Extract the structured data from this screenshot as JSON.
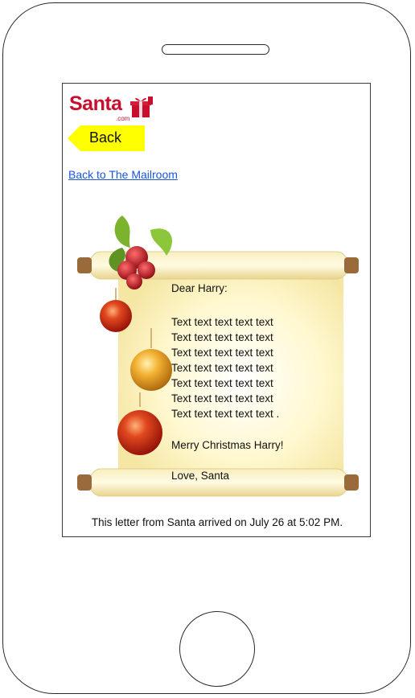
{
  "logo": {
    "brand": "Santa",
    "domain": ".com"
  },
  "nav": {
    "back_label": "Back",
    "mailroom_link": "Back to The Mailroom"
  },
  "letter": {
    "greeting": "Dear Harry:",
    "body_lines": [
      "Text text text text text",
      "Text text text text text",
      "Text text text text text",
      "Text text text text text",
      "Text text text text text",
      "Text text text text text",
      "Text text text text text  ."
    ],
    "closing": "Merry Christmas Harry!",
    "signoff": "Love, Santa"
  },
  "footer": {
    "arrival_text": "This letter from Santa arrived on July 26 at 5:02 PM."
  },
  "icons": {
    "logo_gift": "gift-icon",
    "back_arrow": "arrow-left-icon"
  },
  "colors": {
    "brand_red": "#c8102e",
    "back_yellow": "#ffff00",
    "link_blue": "#1a55d8",
    "scroll_paper": "#fff6c4"
  }
}
